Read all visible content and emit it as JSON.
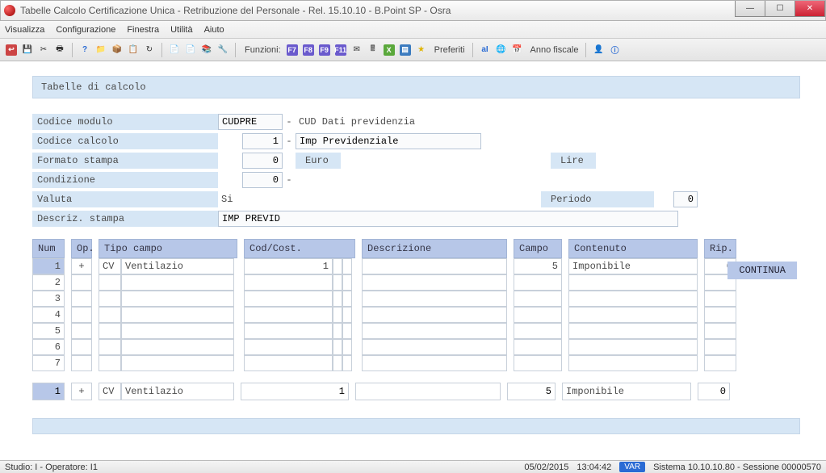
{
  "window": {
    "title": "Tabelle Calcolo Certificazione Unica - Retribuzione del Personale - Rel. 15.10.10 - B.Point SP - Osra"
  },
  "menu": {
    "items": [
      "Visualizza",
      "Configurazione",
      "Finestra",
      "Utilità",
      "Aiuto"
    ]
  },
  "toolbar": {
    "funzioni_label": "Funzioni:",
    "preferiti_label": "Preferiti",
    "anno_label": "Anno fiscale"
  },
  "panel": {
    "title": "Tabelle di calcolo"
  },
  "form": {
    "codice_modulo_label": "Codice modulo",
    "codice_modulo_value": "CUDPRE",
    "codice_modulo_desc": "CUD Dati previdenzia",
    "codice_calcolo_label": "Codice calcolo",
    "codice_calcolo_value": "1",
    "codice_calcolo_desc": "Imp Previdenziale",
    "formato_label": "Formato stampa",
    "formato_value": "0",
    "euro_label": "Euro",
    "lire_label": "Lire",
    "condizione_label": "Condizione",
    "condizione_value": "0",
    "valuta_label": "Valuta",
    "valuta_value": "Si",
    "periodo_label": "Periodo",
    "periodo_value": "0",
    "descriz_label": "Descriz. stampa",
    "descriz_value": "IMP PREVID",
    "continua": "CONTINUA"
  },
  "grid": {
    "headers": {
      "num": "Num",
      "op": "Op.",
      "tipo": "Tipo campo",
      "cod": "Cod/Cost.",
      "desc": "Descrizione",
      "campo": "Campo",
      "cont": "Contenuto",
      "rip": "Rip."
    },
    "rows": [
      {
        "num": "1",
        "op": "+",
        "cv": "CV",
        "tipo": "Ventilazio",
        "cod": "1",
        "desc": "",
        "campo": "5",
        "cont": "Imponibile",
        "rip": "0"
      },
      {
        "num": "2"
      },
      {
        "num": "3"
      },
      {
        "num": "4"
      },
      {
        "num": "5"
      },
      {
        "num": "6"
      },
      {
        "num": "7"
      }
    ],
    "edit": {
      "num": "1",
      "op": "+",
      "cv": "CV",
      "tipo": "Ventilazio",
      "cod": "1",
      "desc": "",
      "campo": "5",
      "cont": "Imponibile",
      "rip": "0"
    }
  },
  "status": {
    "left": "Studio: I - Operatore: I1",
    "date": "05/02/2015",
    "time": "13:04:42",
    "var": "VAR",
    "right": "Sistema 10.10.10.80 - Sessione 00000570"
  }
}
